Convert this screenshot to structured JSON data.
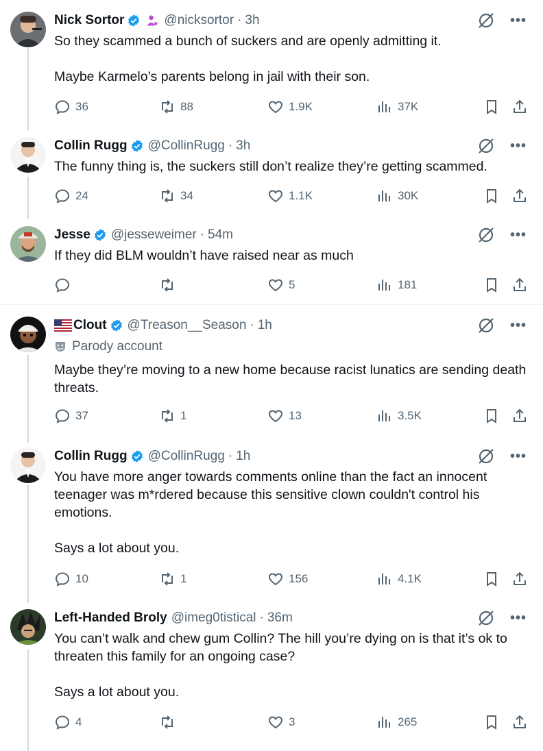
{
  "tweets": [
    {
      "name": "Nick Sortor",
      "handle": "@nicksortor",
      "time": "3h",
      "text": "So they scammed a bunch of suckers and are openly admitting it.\n\nMaybe Karmelo’s parents belong in jail with their son.",
      "replies": "36",
      "retweets": "88",
      "likes": "1.9K",
      "views": "37K"
    },
    {
      "name": "Collin Rugg",
      "handle": "@CollinRugg",
      "time": "3h",
      "text": "The funny thing is, the suckers still don’t realize they’re getting scammed.",
      "replies": "24",
      "retweets": "34",
      "likes": "1.1K",
      "views": "30K"
    },
    {
      "name": "Jesse",
      "handle": "@jesseweimer",
      "time": "54m",
      "text": "If they did BLM wouldn’t have raised near as much",
      "replies": "",
      "retweets": "",
      "likes": "5",
      "views": "181"
    },
    {
      "name": "Clout",
      "handle": "@Treason__Season",
      "time": "1h",
      "badge": "Parody account",
      "text": "Maybe they’re moving to a new home because racist lunatics are sending death threats.",
      "replies": "37",
      "retweets": "1",
      "likes": "13",
      "views": "3.5K"
    },
    {
      "name": "Collin Rugg",
      "handle": "@CollinRugg",
      "time": "1h",
      "text": "You have more anger towards comments online than the fact an innocent teenager was m*rdered because this sensitive clown couldn't control his emotions.\n\nSays a lot about you.",
      "replies": "10",
      "retweets": "1",
      "likes": "156",
      "views": "4.1K"
    },
    {
      "name": "Left-Handed Broly",
      "handle": "@imeg0tistical",
      "time": "36m",
      "text": "You can’t walk and chew gum Collin? The hill you’re dying on is that it’s ok to threaten this family for an ongoing case?\n\nSays a lot about you.",
      "replies": "4",
      "retweets": "",
      "likes": "3",
      "views": "265"
    }
  ],
  "separator": "·",
  "more_icon": "•••",
  "colors": {
    "verified": "#1d9bf0",
    "text": "#0f1419",
    "secondary": "#536471",
    "thread": "#cfd9de"
  }
}
